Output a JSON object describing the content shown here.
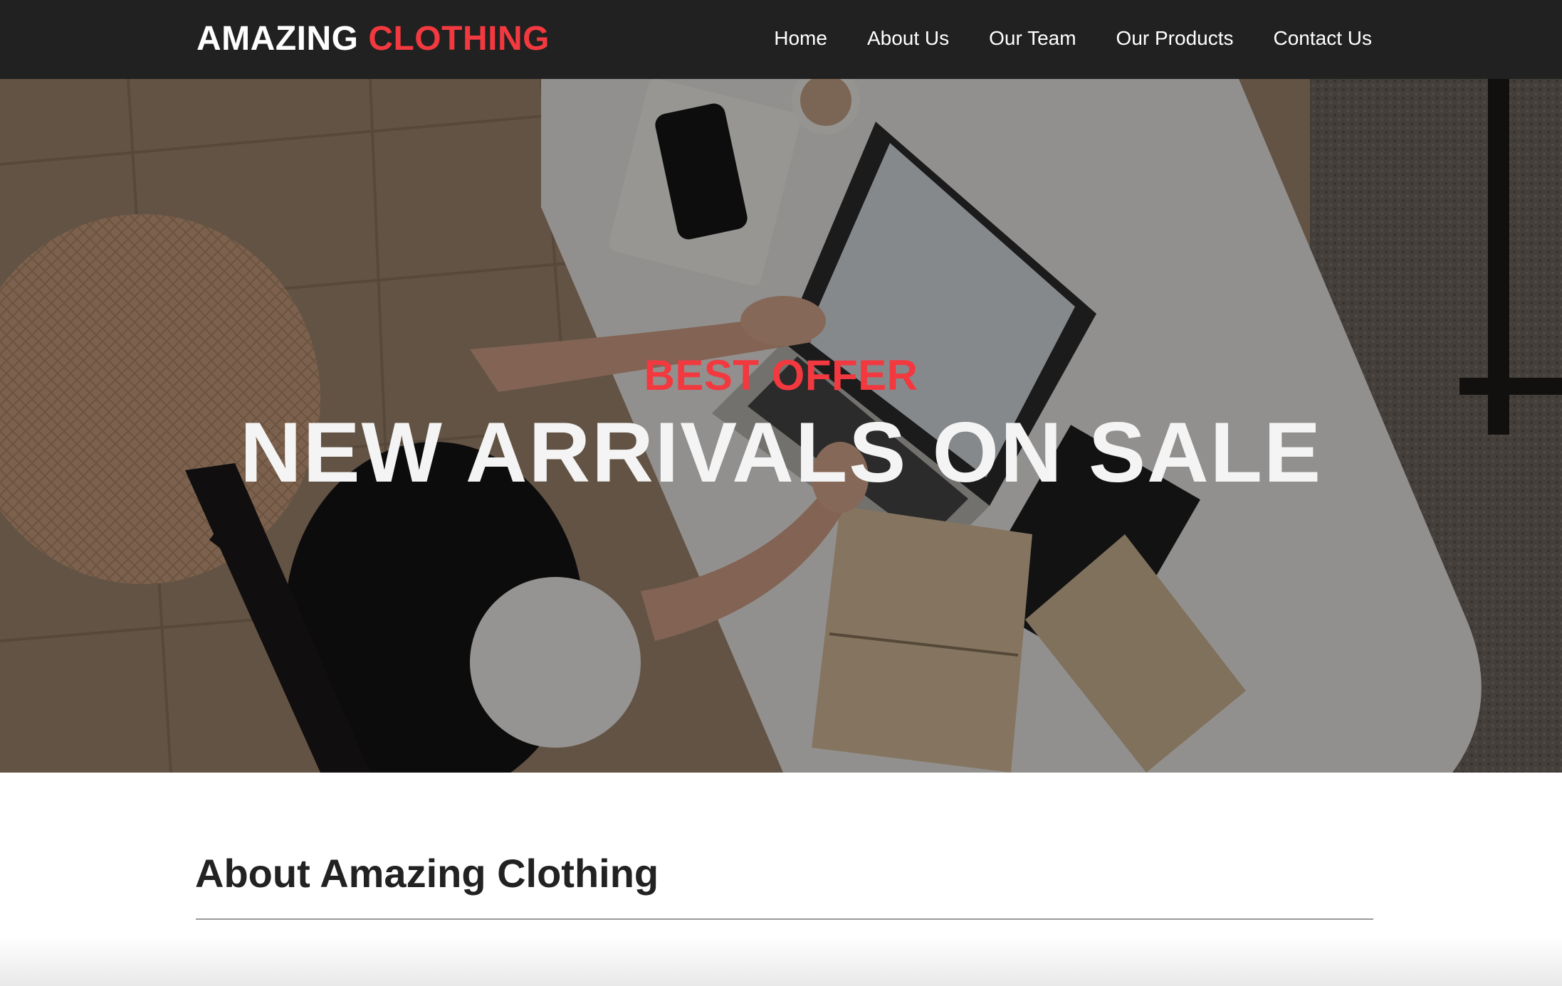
{
  "brand": {
    "word1": "AMAZING",
    "word2": "CLOTHING",
    "accent_color": "#f2393f"
  },
  "nav": {
    "items": [
      {
        "label": "Home"
      },
      {
        "label": "About Us"
      },
      {
        "label": "Our Team"
      },
      {
        "label": "Our Products"
      },
      {
        "label": "Contact Us"
      }
    ]
  },
  "hero": {
    "kicker": "BEST OFFER",
    "title": "NEW ARRIVALS ON SALE",
    "image_subject": "overhead photo of a woman working on a laptop at a white desk with phone, notebook and books"
  },
  "about": {
    "heading": "About Amazing Clothing"
  },
  "colors": {
    "navbar_bg": "#212121",
    "accent": "#f2393f",
    "heading_text": "#222222"
  }
}
